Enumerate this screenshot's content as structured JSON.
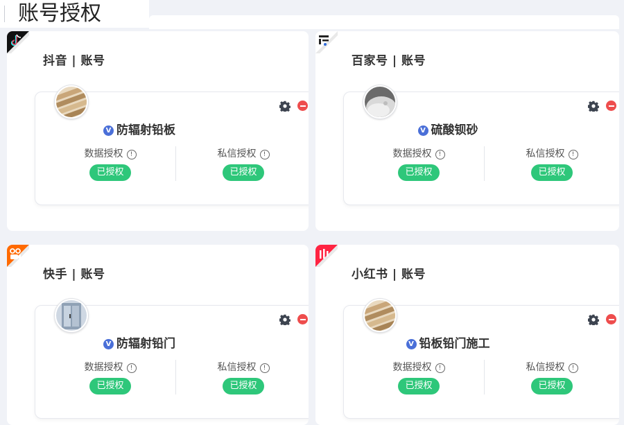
{
  "page": {
    "title": "账号授权"
  },
  "cards": [
    {
      "platform_title": "抖音 | 账号",
      "platform_icon": "douyin-icon",
      "account_name": "防辐射铅板",
      "verified_mark": "V",
      "data_auth_label": "数据授权",
      "msg_auth_label": "私信授权",
      "data_auth_status": "已授权",
      "msg_auth_status": "已授权",
      "info_mark": "!"
    },
    {
      "platform_title": "百家号 | 账号",
      "platform_icon": "baijiahao-icon",
      "account_name": "硫酸钡砂",
      "verified_mark": "V",
      "data_auth_label": "数据授权",
      "msg_auth_label": "私信授权",
      "data_auth_status": "已授权",
      "msg_auth_status": "已授权",
      "info_mark": "!"
    },
    {
      "platform_title": "快手 | 账号",
      "platform_icon": "kuaishou-icon",
      "account_name": "防辐射铅门",
      "verified_mark": "V",
      "data_auth_label": "数据授权",
      "msg_auth_label": "私信授权",
      "data_auth_status": "已授权",
      "msg_auth_status": "已授权",
      "info_mark": "!"
    },
    {
      "platform_title": "小红书 | 账号",
      "platform_icon": "xiaohongshu-icon",
      "account_name": "铅板铅门施工",
      "verified_mark": "V",
      "data_auth_label": "数据授权",
      "msg_auth_label": "私信授权",
      "data_auth_status": "已授权",
      "msg_auth_status": "已授权",
      "info_mark": "!"
    }
  ],
  "colors": {
    "background": "#f0f2f7",
    "status_green": "#2ec77a",
    "remove_red": "#ee4d4d",
    "verified_blue": "#4a6fd8",
    "douyin": "#000000",
    "kuaishou": "#ff6a00",
    "xiaohongshu": "#ff2442"
  }
}
